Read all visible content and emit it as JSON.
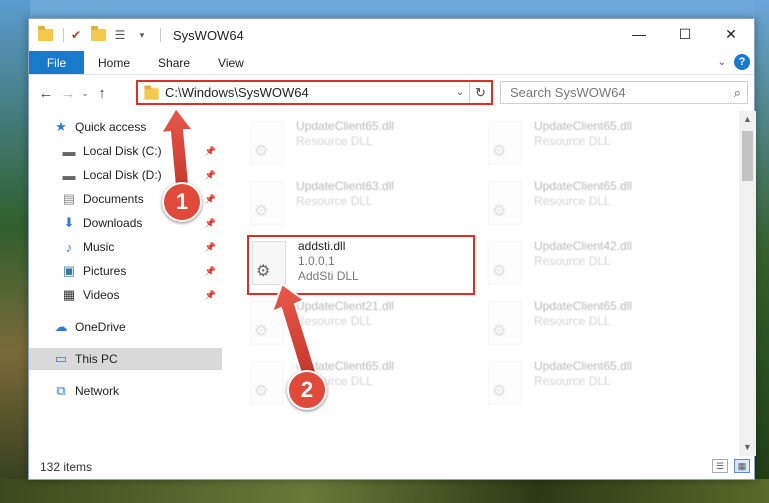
{
  "window": {
    "title": "SysWOW64",
    "controls": {
      "minimize": "—",
      "maximize": "☐",
      "close": "✕"
    }
  },
  "ribbon": {
    "file": "File",
    "tabs": [
      "Home",
      "Share",
      "View"
    ],
    "help": "?"
  },
  "address": {
    "path": "C:\\Windows\\SysWOW64"
  },
  "search": {
    "placeholder": "Search SysWOW64"
  },
  "sidebar": {
    "items": [
      {
        "label": "Quick access",
        "icon": "star-icon",
        "pinned": false
      },
      {
        "label": "Local Disk (C:)",
        "icon": "drive-icon",
        "pinned": true
      },
      {
        "label": "Local Disk (D:)",
        "icon": "drive-icon",
        "pinned": true
      },
      {
        "label": "Documents",
        "icon": "documents-icon",
        "pinned": true
      },
      {
        "label": "Downloads",
        "icon": "download-icon",
        "pinned": true
      },
      {
        "label": "Music",
        "icon": "music-icon",
        "pinned": true
      },
      {
        "label": "Pictures",
        "icon": "pictures-icon",
        "pinned": true
      },
      {
        "label": "Videos",
        "icon": "videos-icon",
        "pinned": true
      },
      {
        "label": "OneDrive",
        "icon": "cloud-icon",
        "pinned": false
      },
      {
        "label": "This PC",
        "icon": "computer-icon",
        "pinned": false,
        "selected": true
      },
      {
        "label": "Network",
        "icon": "network-icon",
        "pinned": false
      }
    ]
  },
  "files": [
    {
      "name": "UpdateClient65.dll",
      "sub": "Resource DLL",
      "faded": true
    },
    {
      "name": "UpdateClient65.dll",
      "sub": "Resource DLL",
      "faded": true
    },
    {
      "name": "UpdateClient63.dll",
      "sub": "Resource DLL",
      "faded": true
    },
    {
      "name": "UpdateClient65.dll",
      "sub": "Resource DLL",
      "faded": true
    },
    {
      "name": "addsti.dll",
      "version": "1.0.0.1",
      "sub": "AddSti DLL",
      "faded": false
    },
    {
      "name": "UpdateClient42.dll",
      "sub": "Resource DLL",
      "faded": true
    },
    {
      "name": "UpdateClient21.dll",
      "sub": "Resource DLL",
      "faded": true
    },
    {
      "name": "UpdateClient65.dll",
      "sub": "Resource DLL",
      "faded": true
    },
    {
      "name": "UpdateClient65.dll",
      "sub": "Resource DLL",
      "faded": true
    },
    {
      "name": "UpdateClient65.dll",
      "sub": "Resource DLL",
      "faded": true
    }
  ],
  "status": {
    "count": "132 items"
  },
  "annotations": {
    "badge1": "1",
    "badge2": "2",
    "color": "#d9302a"
  }
}
